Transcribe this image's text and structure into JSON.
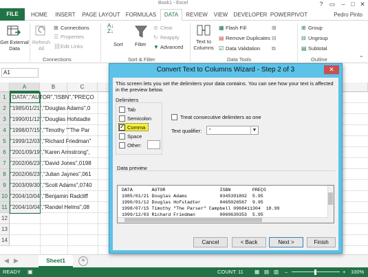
{
  "window": {
    "title": "Book1 - Excel",
    "user": "Pedro Pinto"
  },
  "ribbon_tabs": [
    "FILE",
    "HOME",
    "INSERT",
    "PAGE LAYOUT",
    "FORMULAS",
    "DATA",
    "REVIEW",
    "VIEW",
    "DEVELOPER",
    "POWERPIVOT"
  ],
  "ribbon": {
    "get_external_data": "Get External Data",
    "refresh_all": "Refresh All",
    "connections": "Connections",
    "properties": "Properties",
    "edit_links": "Edit Links",
    "sort": "Sort",
    "filter": "Filter",
    "clear": "Clear",
    "reapply": "Reapply",
    "advanced": "Advanced",
    "text_to_columns": "Text to Columns",
    "flash_fill": "Flash Fill",
    "remove_duplicates": "Remove Duplicates",
    "data_validation": "Data Validation",
    "group": "Group",
    "ungroup": "Ungroup",
    "subtotal": "Subtotal",
    "groups": {
      "connections": "Connections",
      "sort_filter": "Sort & Filter",
      "data_tools": "Data Tools",
      "outline": "Outline"
    }
  },
  "formula_bar": {
    "name_box": "A1"
  },
  "grid": {
    "columns": [
      "A",
      "B",
      "C"
    ],
    "rows": [
      {
        "num": "1",
        "text": "\"DATA\",\"AUTOR\",\"ISBN\",\"PREÇO"
      },
      {
        "num": "2",
        "text": "\"1985/01/21\",\"Douglas Adams\",0"
      },
      {
        "num": "3",
        "text": "\"1990/01/12\",\"Douglas Hofstadte"
      },
      {
        "num": "4",
        "text": "\"1998/07/15\",\"Timothy \"\"The Par"
      },
      {
        "num": "5",
        "text": "\"1999/12/03\",\"Richard Friedman\""
      },
      {
        "num": "6",
        "text": "\"2001/09/19\",\"Karen Armstrong\","
      },
      {
        "num": "7",
        "text": "\"2002/06/23\",\"David Jones\",0198"
      },
      {
        "num": "8",
        "text": "\"2002/06/23\",\"Julian Jaynes\",061"
      },
      {
        "num": "9",
        "text": "\"2003/09/30\",\"Scott Adams\",0740"
      },
      {
        "num": "10",
        "text": "\"2004/10/04\",\"Benjamin Radcliff"
      },
      {
        "num": "11",
        "text": "\"2004/10/04\",\"Randel Helms\",08"
      },
      {
        "num": "12",
        "text": ""
      },
      {
        "num": "13",
        "text": ""
      },
      {
        "num": "14",
        "text": ""
      }
    ]
  },
  "sheet_tabs": [
    "Sheet1"
  ],
  "status": {
    "ready": "READY",
    "count": "COUNT: 11",
    "zoom": "100%"
  },
  "dialog": {
    "title": "Convert Text to Columns Wizard - Step 2 of 3",
    "intro": "This screen lets you set the delimiters your data contains.  You can see how your text is affected in the preview below.",
    "delimiters_label": "Delimiters",
    "delimiters": [
      {
        "label": "Tab",
        "checked": false
      },
      {
        "label": "Semicolon",
        "checked": false
      },
      {
        "label": "Comma",
        "checked": true
      },
      {
        "label": "Space",
        "checked": false
      },
      {
        "label": "Other:",
        "checked": false
      }
    ],
    "consecutive_label": "Treat consecutive delimiters as one",
    "qualifier_label": "Text qualifier:",
    "qualifier_value": "\"",
    "preview_label": "Data preview",
    "preview_rows": [
      "DATA       AUTOR                    ISBN        PREÇO",
      "1985/01/21 Douglas Adams            0345391802  5.95",
      "1990/01/12 Douglas Hofstadter       0465026567  9.95",
      "1998/07/15 Timothy \"The Parser\" Campbell 0968411304  18.99",
      "1999/12/03 Richard Friedman         0060630353  5.95"
    ],
    "buttons": {
      "cancel": "Cancel",
      "back": "< Back",
      "next": "Next >",
      "finish": "Finish"
    }
  },
  "colors": {
    "excel_green": "#217346",
    "dialog_frame": "#5cc2e8",
    "highlight": "#f5ee3a"
  }
}
